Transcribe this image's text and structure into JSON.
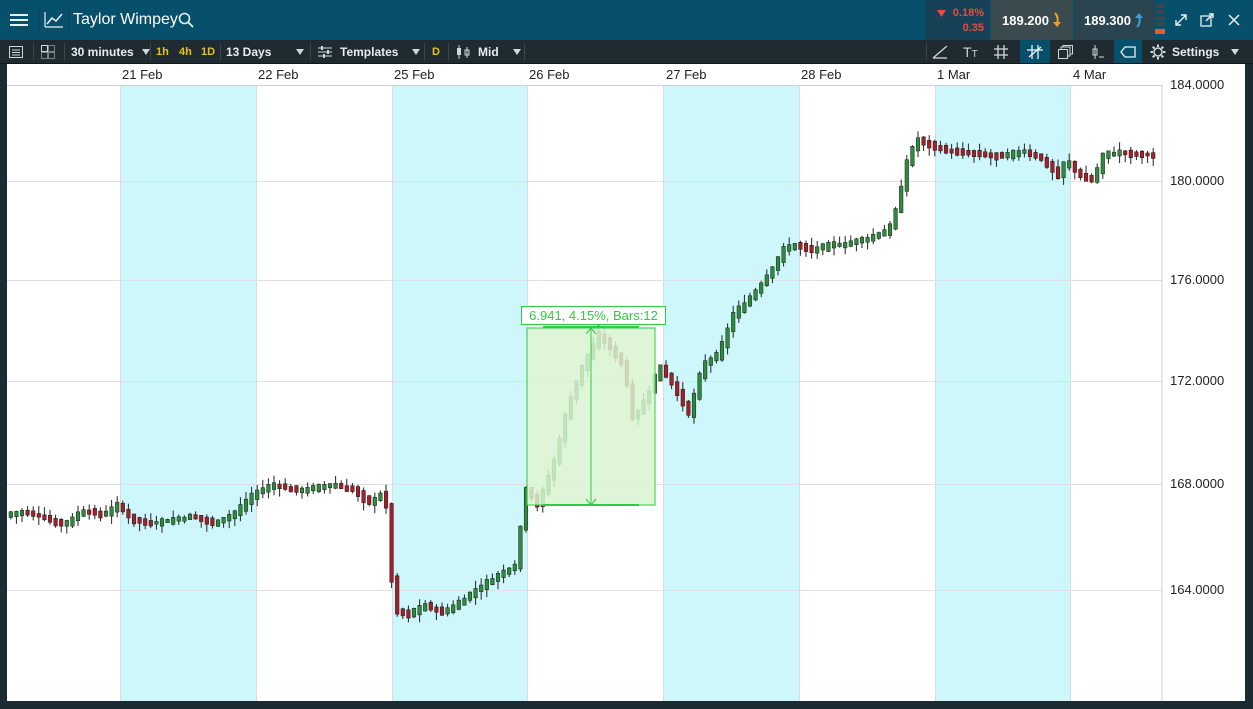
{
  "header": {
    "title": "Taylor Wimpey",
    "change_pct": "0.18%",
    "change_abs": "0.35",
    "sell_price": "189.200",
    "buy_price": "189.300"
  },
  "toolbar": {
    "interval": "30 minutes",
    "quick": [
      "1h",
      "4h",
      "1D"
    ],
    "range": "13 Days",
    "templates": "Templates",
    "d_badge": "D",
    "price_type": "Mid",
    "settings": "Settings"
  },
  "chart": {
    "dates": [
      "21 Feb",
      "22 Feb",
      "25 Feb",
      "26 Feb",
      "27 Feb",
      "28 Feb",
      "1 Mar",
      "4 Mar"
    ],
    "price_ticks": [
      "184.0000",
      "180.0000",
      "176.0000",
      "172.0000",
      "168.0000",
      "164.0000"
    ],
    "measurement": "6.941, 4.15%, Bars:12"
  },
  "colors": {
    "up": "#2e8b3e",
    "down": "#a51f2b",
    "band": "#cef7fb",
    "accent": "#06506b",
    "measure": "#2ecc40"
  }
}
